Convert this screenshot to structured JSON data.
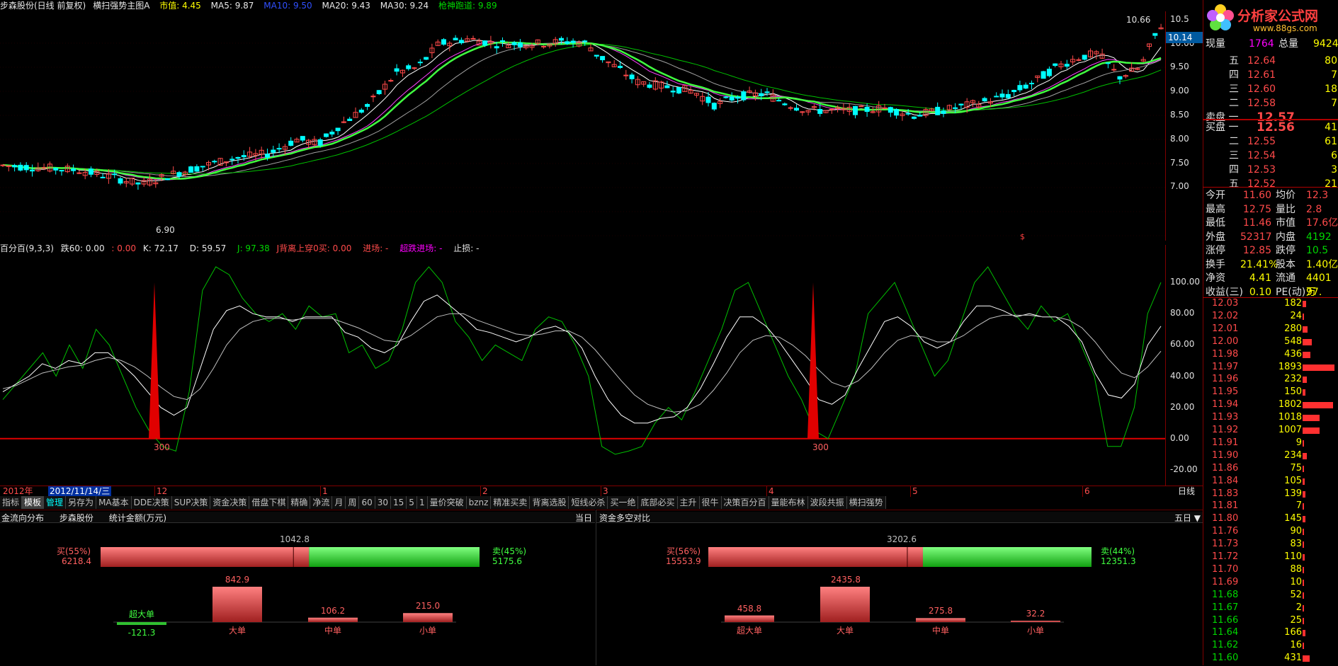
{
  "header": {
    "stock": "步森股份(日线 前复权)",
    "indicator": "横扫强势主图A",
    "mkt": "市值: 4.45",
    "ma5": "MA5: 9.87",
    "ma10": "MA10: 9.50",
    "ma20": "MA20: 9.43",
    "ma30": "MA30: 9.24",
    "spear": "枪神跑道: 9.89"
  },
  "colors": {
    "up": "#ff4a4a",
    "down": "#00ffff",
    "green": "#00d700",
    "magenta": "#ff00ff",
    "bg": "#000000"
  },
  "main_chart": {
    "price_ticks": [
      "10.5",
      "10.00",
      "9.50",
      "9.00",
      "8.50",
      "8.00",
      "7.50",
      "7.00"
    ],
    "high_label": "10.66",
    "low_label": "6.90",
    "last_price": "10.14",
    "marker": "$"
  },
  "oscillator": {
    "title": "百分百(9,3,3)",
    "fields": [
      "跌60: 0.00",
      ": 0.00",
      "K: 72.17",
      "D: 59.57",
      "J: 97.38",
      "J背离上穿0买: 0.00",
      "进场: -",
      "超跌进场: -",
      "止损: -"
    ],
    "ticks": [
      "100.00",
      "80.00",
      "60.00",
      "40.00",
      "20.00",
      "0.00",
      "-20.00"
    ],
    "signal_label": "300",
    "chart_data": {
      "type": "line",
      "series": [
        {
          "name": "J",
          "values": [
            25,
            35,
            45,
            55,
            40,
            60,
            45,
            70,
            60,
            40,
            20,
            5,
            -5,
            -8,
            30,
            95,
            110,
            105,
            90,
            80,
            75,
            80,
            70,
            85,
            78,
            80,
            55,
            60,
            45,
            50,
            70,
            100,
            110,
            100,
            75,
            65,
            50,
            60,
            55,
            50,
            70,
            78,
            75,
            60,
            40,
            -5,
            -10,
            -8,
            -5,
            10,
            20,
            12,
            30,
            50,
            70,
            95,
            100,
            80,
            60,
            40,
            25,
            5,
            0,
            20,
            40,
            80,
            90,
            100,
            80,
            60,
            40,
            50,
            75,
            100,
            110,
            95,
            80,
            70,
            85,
            75,
            80,
            60,
            40,
            -5,
            -5,
            20,
            80,
            100
          ]
        },
        {
          "name": "K",
          "values": [
            30,
            35,
            40,
            48,
            45,
            50,
            48,
            55,
            55,
            48,
            40,
            30,
            20,
            15,
            20,
            45,
            70,
            82,
            85,
            80,
            78,
            78,
            75,
            78,
            78,
            78,
            68,
            65,
            58,
            55,
            60,
            75,
            88,
            92,
            85,
            78,
            70,
            68,
            65,
            62,
            65,
            70,
            72,
            68,
            58,
            40,
            25,
            15,
            10,
            10,
            13,
            14,
            20,
            32,
            48,
            65,
            78,
            78,
            72,
            62,
            50,
            38,
            25,
            22,
            28,
            45,
            60,
            75,
            78,
            72,
            62,
            58,
            62,
            75,
            85,
            85,
            82,
            78,
            80,
            78,
            78,
            72,
            62,
            42,
            28,
            26,
            35,
            60,
            72
          ]
        },
        {
          "name": "D",
          "values": [
            32,
            34,
            38,
            42,
            44,
            46,
            47,
            50,
            52,
            50,
            46,
            40,
            33,
            27,
            25,
            32,
            45,
            60,
            70,
            75,
            77,
            77,
            76,
            77,
            77,
            77,
            74,
            71,
            67,
            63,
            62,
            66,
            72,
            78,
            80,
            80,
            76,
            73,
            70,
            67,
            66,
            67,
            69,
            69,
            65,
            57,
            47,
            37,
            28,
            22,
            19,
            17,
            18,
            22,
            31,
            42,
            55,
            63,
            66,
            65,
            60,
            53,
            44,
            36,
            33,
            37,
            45,
            55,
            63,
            66,
            65,
            62,
            62,
            66,
            72,
            77,
            79,
            79,
            79,
            78,
            78,
            76,
            71,
            62,
            51,
            42,
            39,
            46,
            56
          ]
        }
      ],
      "ylim": [
        -30,
        115
      ]
    }
  },
  "timeline": {
    "year": "2012年",
    "date": "2012/11/14/三",
    "months": [
      "12",
      "1",
      "2",
      "3",
      "4",
      "5",
      "6"
    ],
    "period": "日线"
  },
  "tabs": [
    "指标",
    "模板",
    "管理",
    "另存为",
    "MA基本",
    "DDE决策",
    "SUP决策",
    "资金决策",
    "借盘下棋",
    "精确",
    "净流",
    "月",
    "周",
    "60",
    "30",
    "15",
    "5",
    "1",
    "量价突破",
    "bznz",
    "精准买卖",
    "背离选股",
    "短线必杀",
    "买一绝",
    "底部必买",
    "主升",
    "很牛",
    "决策百分百",
    "量能布林",
    "波段共振",
    "横扫强势"
  ],
  "fund_flow": {
    "title": "金流向分布",
    "stock": "步森股份",
    "unit": "统计金额(万元)",
    "period": "当日",
    "buy_label": "买(55%)",
    "buy_value": "6218.4",
    "sell_label": "卖(45%)",
    "sell_value": "5175.6",
    "diff": "1042.8",
    "buy_fraction": 0.55,
    "bars": [
      {
        "label": "超大单",
        "value": "-121.3",
        "num": -121.3
      },
      {
        "label": "大单",
        "value": "842.9",
        "num": 842.9
      },
      {
        "label": "中单",
        "value": "106.2",
        "num": 106.2
      },
      {
        "label": "小单",
        "value": "215.0",
        "num": 215.0
      }
    ]
  },
  "bull_bear": {
    "title": "资金多空对比",
    "period": "五日 ▼",
    "buy_label": "买(56%)",
    "buy_value": "15553.9",
    "sell_label": "卖(44%)",
    "sell_value": "12351.3",
    "diff": "3202.6",
    "buy_fraction": 0.56,
    "bars": [
      {
        "label": "超大单",
        "value": "458.8",
        "num": 458.8
      },
      {
        "label": "大单",
        "value": "2435.8",
        "num": 2435.8
      },
      {
        "label": "中单",
        "value": "275.8",
        "num": 275.8
      },
      {
        "label": "小单",
        "value": "32.2",
        "num": 32.2
      }
    ]
  },
  "quote": {
    "logo": "分析家公式网",
    "logo_url": "www.88gs.com",
    "volume_label": "现量",
    "volume": "1764",
    "total_label": "总量",
    "total": "9424",
    "asks": [
      {
        "level": "五",
        "price": "12.64",
        "vol": "80"
      },
      {
        "level": "四",
        "price": "12.61",
        "vol": "7"
      },
      {
        "level": "三",
        "price": "12.60",
        "vol": "18"
      },
      {
        "level": "二",
        "price": "12.58",
        "vol": "7"
      },
      {
        "level": "卖盘 一",
        "price": "12.57",
        "vol": ""
      }
    ],
    "bids": [
      {
        "level": "买盘 一",
        "price": "12.56",
        "vol": "41"
      },
      {
        "level": "二",
        "price": "12.55",
        "vol": "61"
      },
      {
        "level": "三",
        "price": "12.54",
        "vol": "6"
      },
      {
        "level": "四",
        "price": "12.53",
        "vol": "3"
      },
      {
        "level": "五",
        "price": "12.52",
        "vol": "21"
      }
    ],
    "stats": [
      {
        "l1": "今开",
        "v1": "11.60",
        "l2": "均价",
        "v2": "12.3"
      },
      {
        "l1": "最高",
        "v1": "12.75",
        "l2": "量比",
        "v2": "2.8"
      },
      {
        "l1": "最低",
        "v1": "11.46",
        "l2": "市值",
        "v2": "17.6亿"
      },
      {
        "l1": "外盘",
        "v1": "52317",
        "l2": "内盘",
        "v2": "4192"
      },
      {
        "l1": "涨停",
        "v1": "12.85",
        "l2": "跌停",
        "v2": "10.5"
      },
      {
        "l1": "换手",
        "v1": "21.41%",
        "l2": "股本",
        "v2": "1.40亿"
      },
      {
        "l1": "净资",
        "v1": "4.41",
        "l2": "流通",
        "v2": "4401万"
      },
      {
        "l1": "收益(三)",
        "v1": "0.10",
        "l2": "PE(动)",
        "v2": "97."
      }
    ],
    "ticks": [
      {
        "price": "12.03",
        "vol": "182",
        "bar": 0.09
      },
      {
        "price": "12.02",
        "vol": "24",
        "bar": 0.01
      },
      {
        "price": "12.01",
        "vol": "280",
        "bar": 0.13
      },
      {
        "price": "12.00",
        "vol": "548",
        "bar": 0.26
      },
      {
        "price": "11.98",
        "vol": "436",
        "bar": 0.21
      },
      {
        "price": "11.97",
        "vol": "1893",
        "bar": 0.9
      },
      {
        "price": "11.96",
        "vol": "232",
        "bar": 0.11
      },
      {
        "price": "11.95",
        "vol": "150",
        "bar": 0.07
      },
      {
        "price": "11.94",
        "vol": "1802",
        "bar": 0.86
      },
      {
        "price": "11.93",
        "vol": "1018",
        "bar": 0.48
      },
      {
        "price": "11.92",
        "vol": "1007",
        "bar": 0.48
      },
      {
        "price": "11.91",
        "vol": "9",
        "bar": 0.005
      },
      {
        "price": "11.90",
        "vol": "234",
        "bar": 0.11
      },
      {
        "price": "11.86",
        "vol": "75",
        "bar": 0.04
      },
      {
        "price": "11.84",
        "vol": "105",
        "bar": 0.05
      },
      {
        "price": "11.83",
        "vol": "139",
        "bar": 0.07
      },
      {
        "price": "11.81",
        "vol": "7",
        "bar": 0.005
      },
      {
        "price": "11.80",
        "vol": "145",
        "bar": 0.07
      },
      {
        "price": "11.76",
        "vol": "90",
        "bar": 0.04
      },
      {
        "price": "11.73",
        "vol": "83",
        "bar": 0.04
      },
      {
        "price": "11.72",
        "vol": "110",
        "bar": 0.05
      },
      {
        "price": "11.70",
        "vol": "88",
        "bar": 0.04
      },
      {
        "price": "11.69",
        "vol": "10",
        "bar": 0.005
      },
      {
        "price": "11.68",
        "vol": "52",
        "bar": 0.02
      },
      {
        "price": "11.67",
        "vol": "2",
        "bar": 0.002
      },
      {
        "price": "11.66",
        "vol": "25",
        "bar": 0.01
      },
      {
        "price": "11.64",
        "vol": "166",
        "bar": 0.08
      },
      {
        "price": "11.62",
        "vol": "16",
        "bar": 0.008
      },
      {
        "price": "11.60",
        "vol": "431",
        "bar": 0.2
      }
    ]
  }
}
